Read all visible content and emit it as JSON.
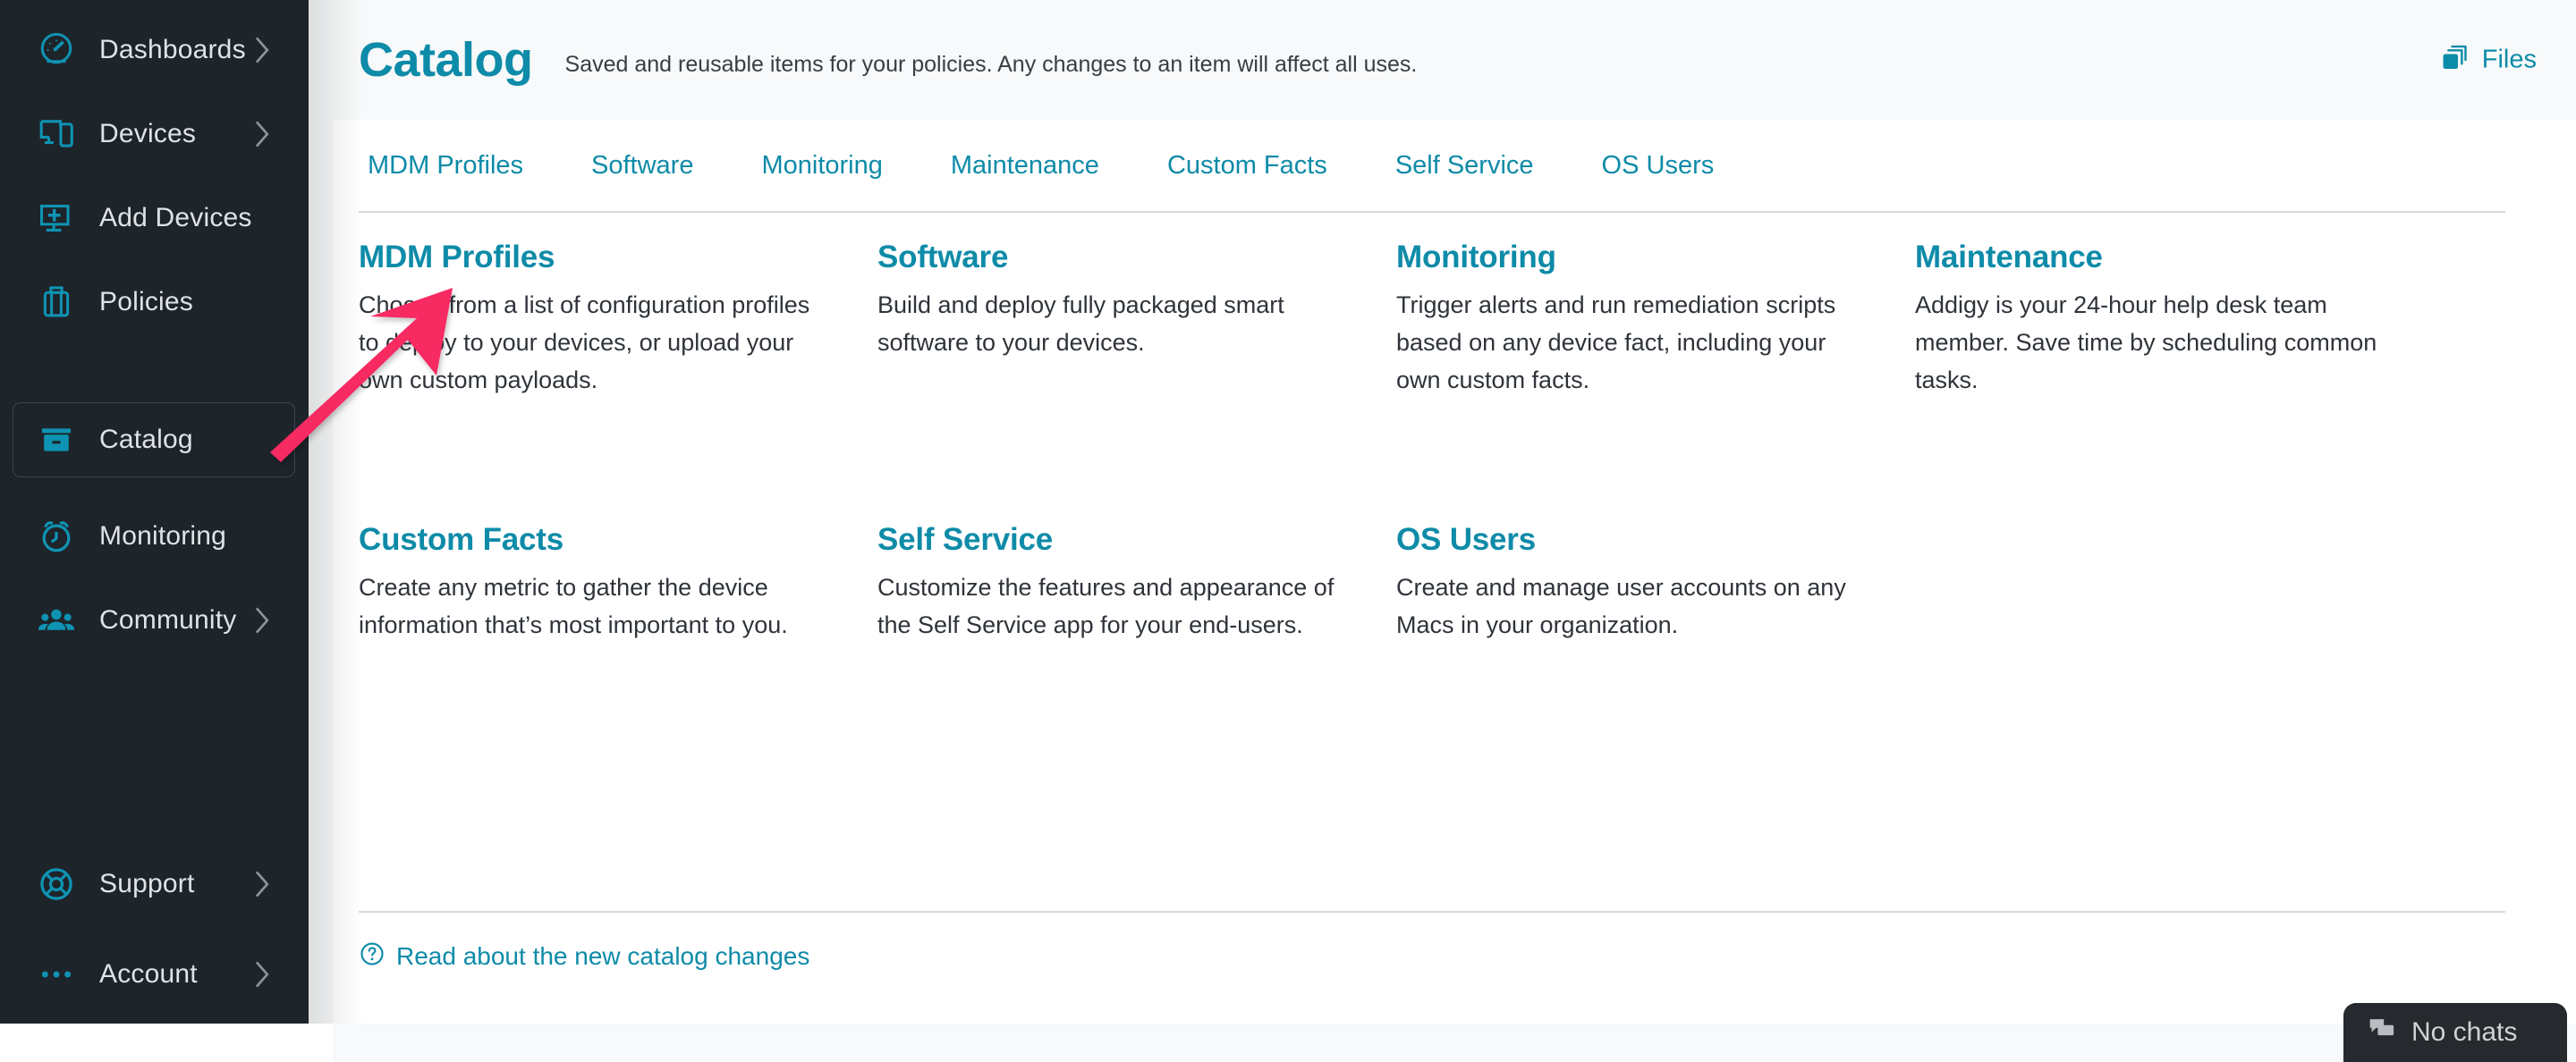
{
  "sidebar": {
    "items": [
      {
        "label": "Dashboards",
        "icon": "gauge-icon",
        "chevron": true,
        "selected": false
      },
      {
        "label": "Devices",
        "icon": "devices-icon",
        "chevron": true,
        "selected": false
      },
      {
        "label": "Add Devices",
        "icon": "add-device-icon",
        "chevron": false,
        "selected": false
      },
      {
        "label": "Policies",
        "icon": "briefcase-icon",
        "chevron": false,
        "selected": false
      },
      {
        "label": "Catalog",
        "icon": "archive-box-icon",
        "chevron": false,
        "selected": true
      },
      {
        "label": "Monitoring",
        "icon": "alarm-clock-icon",
        "chevron": false,
        "selected": false
      },
      {
        "label": "Community",
        "icon": "people-icon",
        "chevron": true,
        "selected": false
      },
      {
        "label": "Support",
        "icon": "life-ring-icon",
        "chevron": true,
        "selected": false
      },
      {
        "label": "Account",
        "icon": "ellipsis-icon",
        "chevron": true,
        "selected": false
      }
    ]
  },
  "header": {
    "title": "Catalog",
    "subtitle": "Saved and reusable items for your policies. Any changes to an item will affect all uses.",
    "files_label": "Files",
    "files_icon": "layers-icon"
  },
  "tabs": [
    {
      "label": "MDM Profiles"
    },
    {
      "label": "Software"
    },
    {
      "label": "Monitoring"
    },
    {
      "label": "Maintenance"
    },
    {
      "label": "Custom Facts"
    },
    {
      "label": "Self Service"
    },
    {
      "label": "OS Users"
    }
  ],
  "tiles": [
    {
      "title": "MDM Profiles",
      "desc": "Choose from a list of configuration profiles to deploy to your devices, or upload your own custom payloads."
    },
    {
      "title": "Software",
      "desc": "Build and deploy fully packaged smart software to your devices."
    },
    {
      "title": "Monitoring",
      "desc": "Trigger alerts and run remediation scripts based on any device fact, including your own custom facts."
    },
    {
      "title": "Maintenance",
      "desc": "Addigy is your 24-hour help desk team member. Save time by scheduling common tasks."
    },
    {
      "title": "Custom Facts",
      "desc": "Create any metric to gather the device information that’s most important to you."
    },
    {
      "title": "Self Service",
      "desc": "Customize the features and appearance of the Self Service app for your end-users."
    },
    {
      "title": "OS Users",
      "desc": "Create and manage user accounts on any Macs in your organization."
    }
  ],
  "footer": {
    "link_label": "Read about the new catalog changes",
    "link_icon": "question-circle-icon"
  },
  "chat": {
    "label": "No chats",
    "icon": "chat-bubbles-icon"
  },
  "annotation": {
    "type": "arrow",
    "color": "#f72a62",
    "points_from": "sidebar-item-catalog",
    "points_to": "tile-mdm-profiles"
  },
  "colors": {
    "accent": "#0e8ba8",
    "sidebar_bg": "#1d242a",
    "sidebar_icon": "#0f93b3",
    "page_bg": "#f7f9fa",
    "annotation": "#f72a62"
  }
}
